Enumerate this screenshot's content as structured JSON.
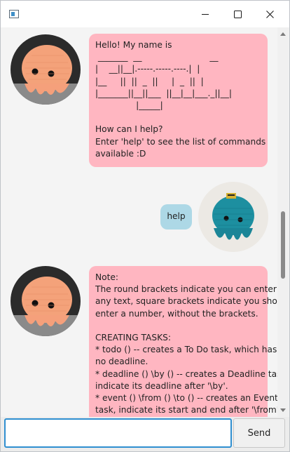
{
  "window": {
    "title": "",
    "icons": {
      "app": "app-window-icon",
      "minimize": "minimize-icon",
      "maximize": "maximize-icon",
      "close": "close-icon"
    }
  },
  "colors": {
    "bot_bubble": "#ffb6c1",
    "user_bubble": "#add8e6",
    "input_focus_border": "#2f8fd0",
    "bot_avatar_body": "#f4a27a",
    "user_avatar_body": "#1d8fa0"
  },
  "messages": [
    {
      "sender": "bot",
      "avatar": "orange-crochet-octopus-avatar",
      "text": "Hello! My name is\n _______  __                         __  \n|    __||__|.-----.-----.----.|  |\n|__     ||  ||  _  ||     |  _  ||  |\n|_______||__||___  ||__|__|___._||__|\n               |_____|\n\nHow can I help?\nEnter 'help' to see the list of commands\navailable :D"
    },
    {
      "sender": "user",
      "avatar": "teal-crochet-octopus-avatar",
      "text": "help"
    },
    {
      "sender": "bot",
      "avatar": "orange-crochet-octopus-avatar",
      "text": "Note:\nThe round brackets indicate you can enter\nany text, square brackets indicate you should\nenter a number, without the brackets.\n\nCREATING TASKS:\n* todo () -- creates a To Do task, which has\nno deadline.\n* deadline () \\by () -- creates a Deadline task,\nindicate its deadline after '\\by'.\n* event () \\from () \\to () -- creates an Event\ntask, indicate its start and end after '\\from'"
    }
  ],
  "input": {
    "value": "",
    "placeholder": ""
  },
  "send_button": {
    "label": "Send"
  }
}
